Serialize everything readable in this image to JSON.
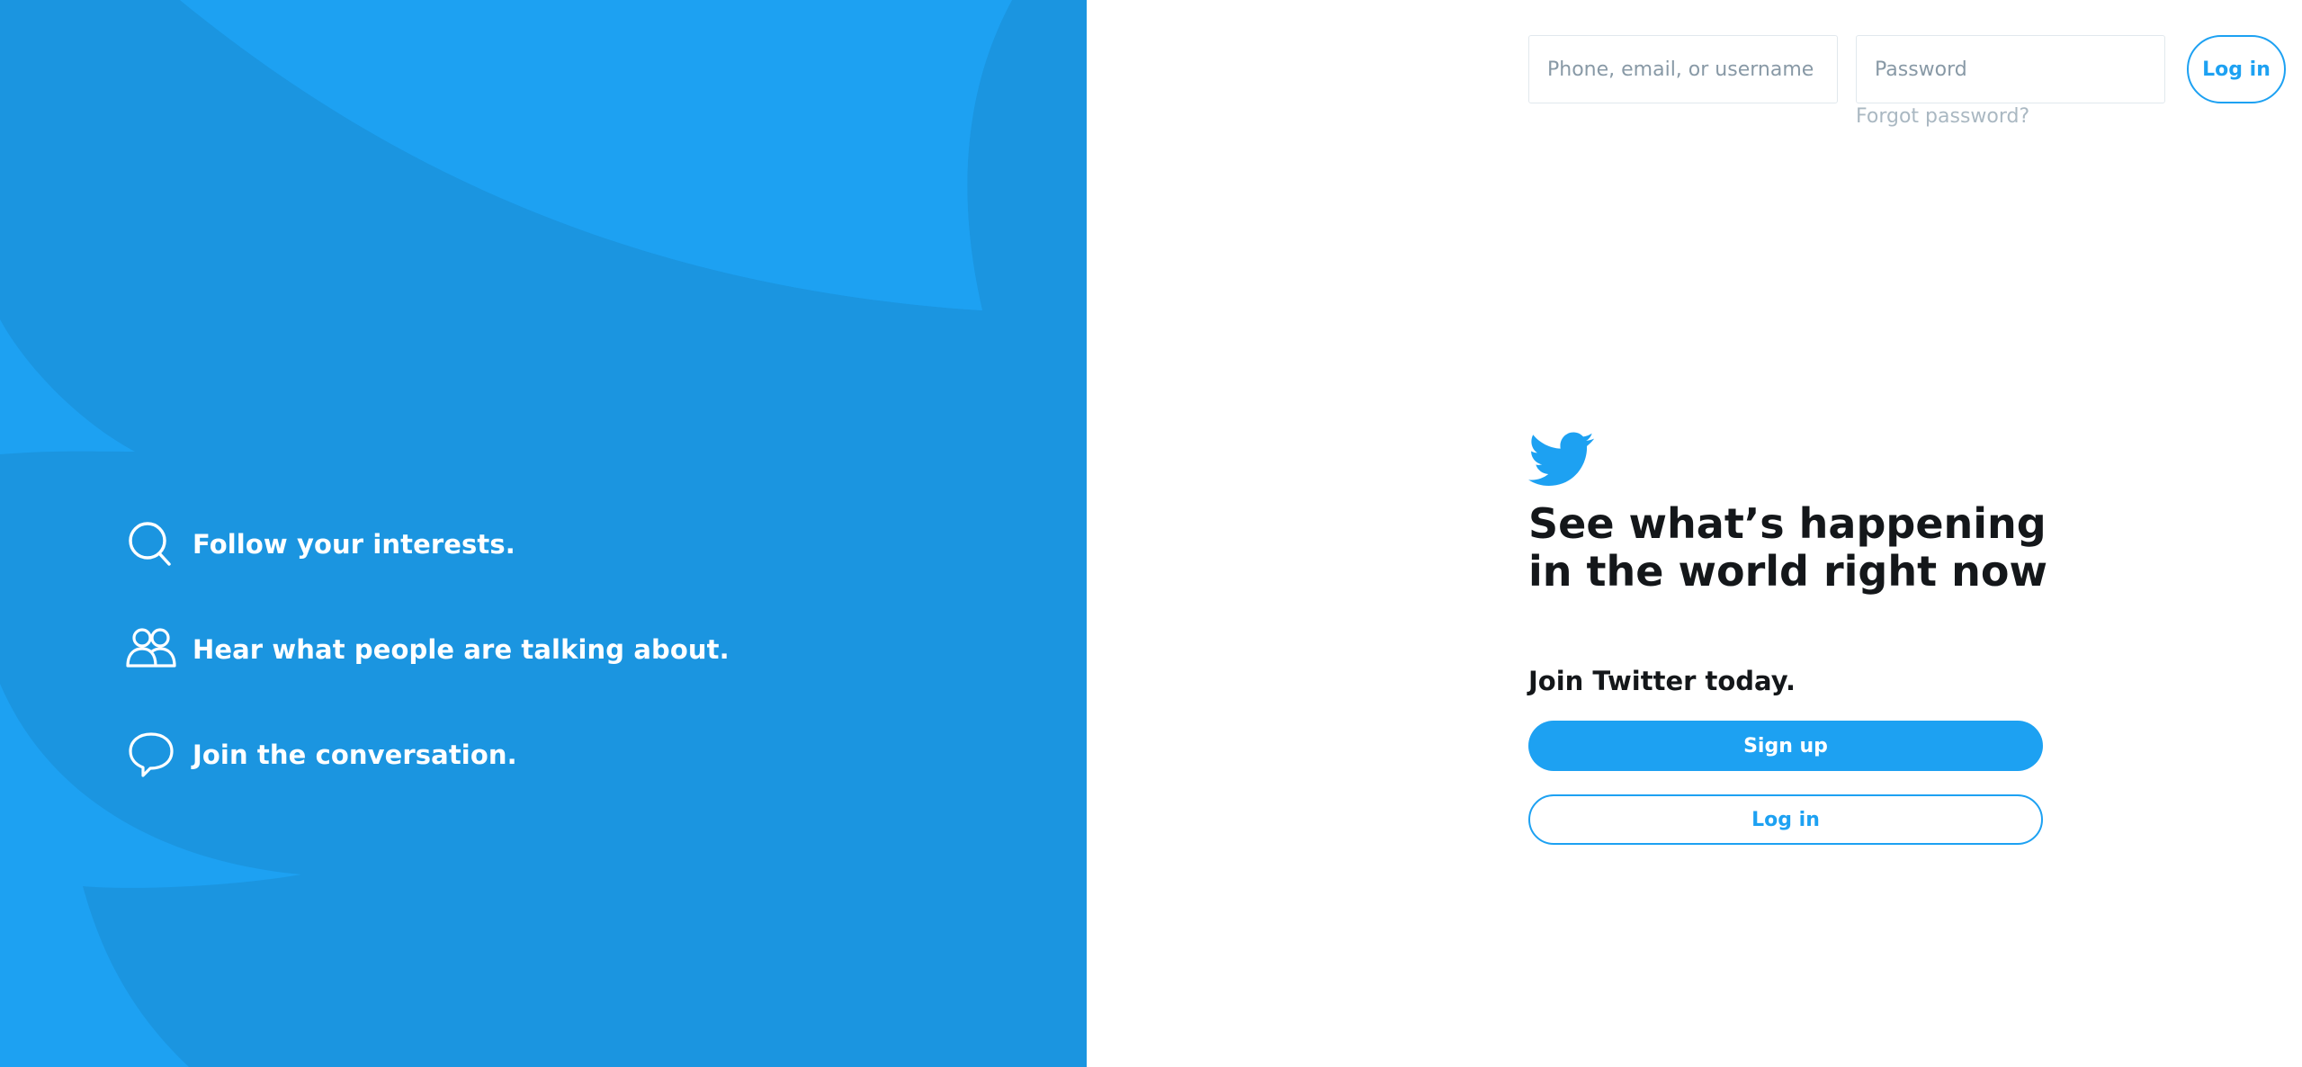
{
  "colors": {
    "brand_blue": "#1da1f2",
    "panel_dark_blue": "#1b95e0",
    "text_dark": "#14171a",
    "muted_gray": "#aab8c2"
  },
  "features": [
    {
      "icon": "search-icon",
      "text": "Follow your interests."
    },
    {
      "icon": "people-icon",
      "text": "Hear what people are talking about."
    },
    {
      "icon": "speech-bubble-icon",
      "text": "Join the conversation."
    }
  ],
  "login_form": {
    "username_placeholder": "Phone, email, or username",
    "password_placeholder": "Password",
    "forgot_password": "Forgot password?",
    "login_label": "Log in"
  },
  "hero": {
    "logo_icon": "twitter-bird-icon",
    "headline": "See what’s happening in the world right now",
    "join_text": "Join Twitter today.",
    "signup_label": "Sign up",
    "login_label": "Log in"
  }
}
